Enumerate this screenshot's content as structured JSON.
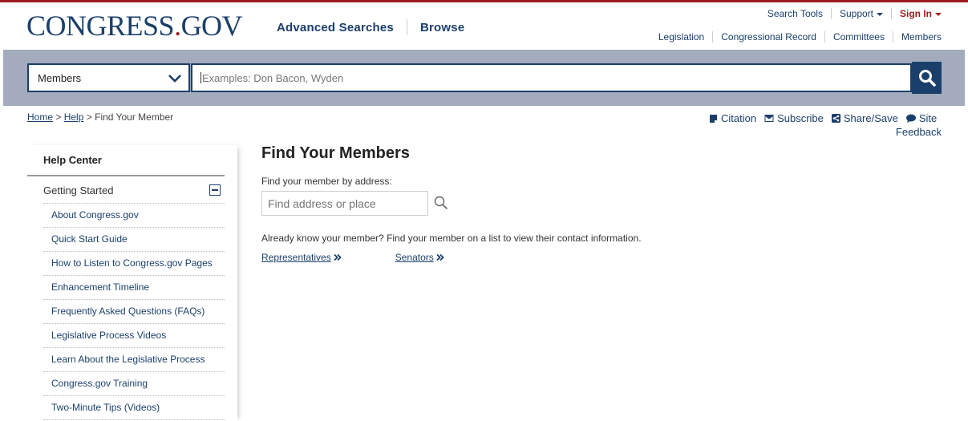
{
  "header": {
    "logo_text": "CONGRESS",
    "logo_dot": ".",
    "logo_suffix": "GOV",
    "main_nav": [
      "Advanced Searches",
      "Browse"
    ],
    "util_nav": {
      "search_tools": "Search Tools",
      "support": "Support",
      "sign_in": "Sign In"
    },
    "secondary_nav": [
      "Legislation",
      "Congressional Record",
      "Committees",
      "Members"
    ]
  },
  "search": {
    "scope_value": "Members",
    "placeholder": "Examples: Don Bacon, Wyden"
  },
  "breadcrumb": {
    "home": "Home",
    "sep": ">",
    "help": "Help",
    "current": "Find Your Member"
  },
  "tools": {
    "citation": "Citation",
    "subscribe": "Subscribe",
    "share": "Share/Save",
    "site": "Site",
    "feedback": "Feedback"
  },
  "sidebar": {
    "title": "Help Center",
    "group": "Getting Started",
    "items": [
      "About Congress.gov",
      "Quick Start Guide",
      "How to Listen to Congress.gov Pages",
      "Enhancement Timeline",
      "Frequently Asked Questions (FAQs)",
      "Legislative Process Videos",
      "Learn About the Legislative Process",
      "Congress.gov Training",
      "Two-Minute Tips (Videos)"
    ]
  },
  "main": {
    "title": "Find Your Members",
    "address_label": "Find your member by address:",
    "address_placeholder": "Find address or place",
    "know_text": "Already know your member? Find your member on a list to view their contact information.",
    "representatives": "Representatives",
    "senators": "Senators"
  },
  "colors": {
    "brand_blue": "#1b3f6b",
    "brand_red": "#9c1d20",
    "search_band": "#a3abbc"
  }
}
